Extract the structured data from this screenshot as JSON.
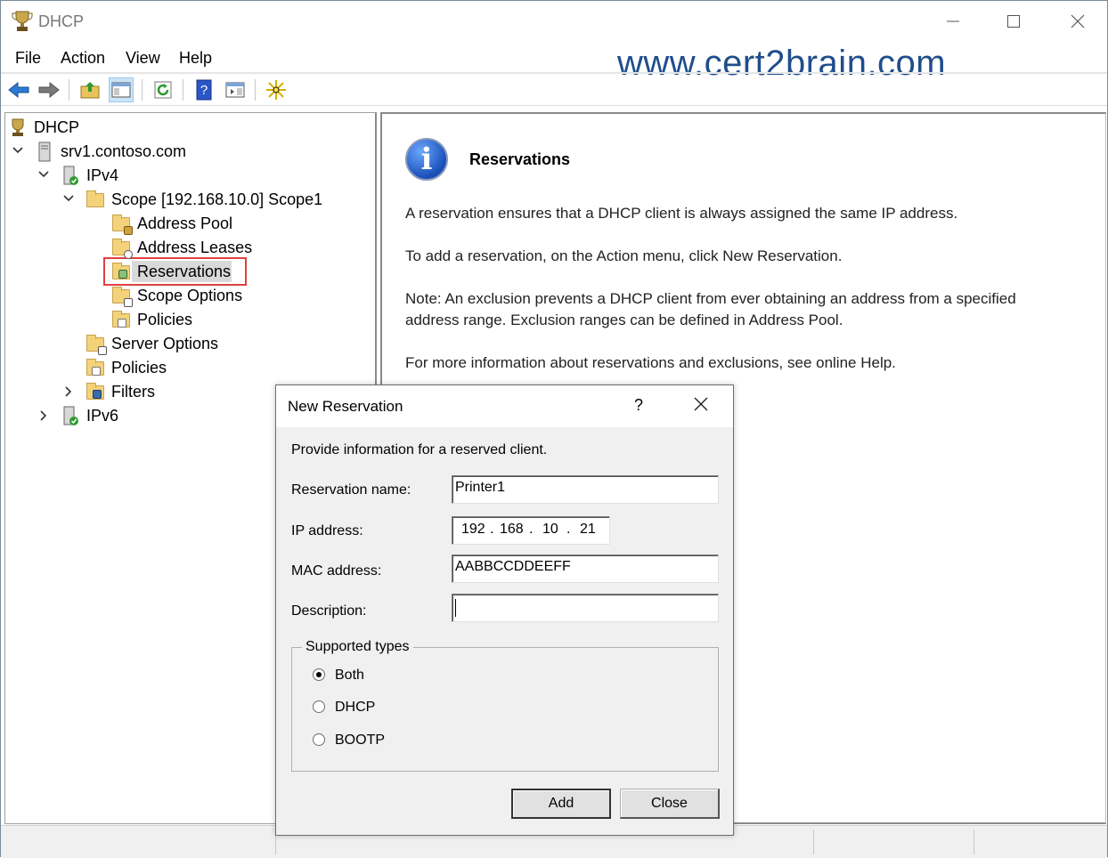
{
  "window": {
    "title": "DHCP"
  },
  "menu": [
    "File",
    "Action",
    "View",
    "Help"
  ],
  "watermark": "www.cert2brain.com",
  "toolbar": [
    "back-icon",
    "forward-icon",
    "up-folder-icon",
    "show-hide-tree-icon",
    "refresh-icon",
    "help-icon",
    "action-pane-icon",
    "new-star-icon"
  ],
  "tree": {
    "root": "DHCP",
    "server": "srv1.contoso.com",
    "ipv4": "IPv4",
    "scope": "Scope [192.168.10.0] Scope1",
    "address_pool": "Address Pool",
    "address_leases": "Address Leases",
    "reservations": "Reservations",
    "scope_options": "Scope Options",
    "scope_policies": "Policies",
    "server_options": "Server Options",
    "policies": "Policies",
    "filters": "Filters",
    "ipv6": "IPv6"
  },
  "detail": {
    "title": "Reservations",
    "p1": "A reservation ensures that a DHCP client is always assigned the same IP address.",
    "p2": "To add a reservation, on the Action menu, click New Reservation.",
    "p3a": "Note: An exclusion prevents a DHCP client from ever obtaining an address from a specified",
    "p3b": "address range.  Exclusion ranges can be defined in Address Pool.",
    "p4": "For more information about reservations and exclusions, see online Help."
  },
  "dialog": {
    "title": "New Reservation",
    "help": "?",
    "intro": "Provide information for a reserved client.",
    "name_label": "Reservation name:",
    "name_value": "Printer1",
    "ip_label": "IP address:",
    "ip": [
      "192",
      "168",
      "10",
      "21"
    ],
    "ip_dot": ".",
    "mac_label": "MAC address:",
    "mac_value": "AABBCCDDEEFF",
    "desc_label": "Description:",
    "desc_value": "",
    "types_label": "Supported types",
    "types": [
      "Both",
      "DHCP",
      "BOOTP"
    ],
    "selected_type": "Both",
    "add": "Add",
    "close": "Close"
  }
}
